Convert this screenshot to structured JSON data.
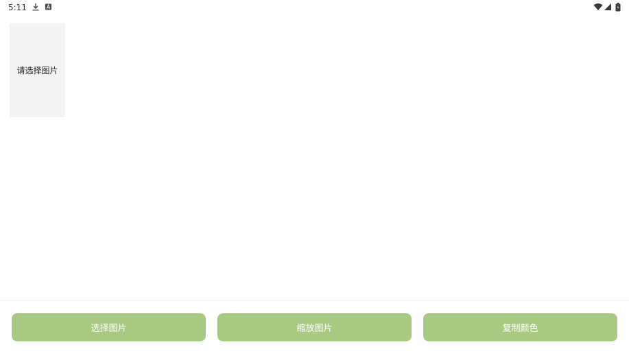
{
  "status_bar": {
    "time": "5:11",
    "icons": [
      "download-icon",
      "a-icon",
      "wifi-icon",
      "cellular-icon",
      "battery-icon"
    ]
  },
  "image_area": {
    "placeholder_text": "请选择图片"
  },
  "actions": {
    "select_label": "选择图片",
    "zoom_label": "缩放图片",
    "copy_label": "复制颜色"
  },
  "colors": {
    "button_bg": "#a8c980",
    "button_text": "#ffffff",
    "placeholder_bg": "#f3f3f3"
  }
}
